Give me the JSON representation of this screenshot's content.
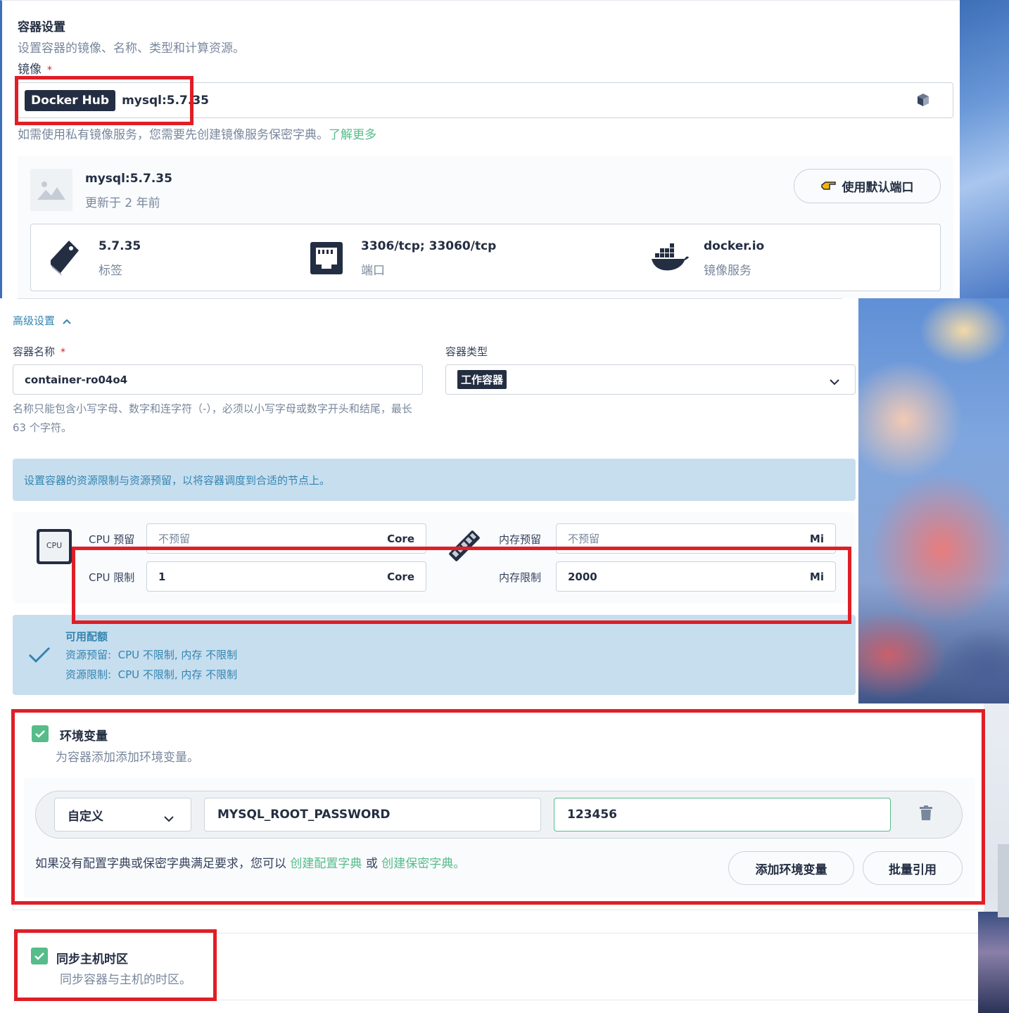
{
  "container_settings": {
    "title": "容器设置",
    "description": "设置容器的镜像、名称、类型和计算资源。",
    "image_label": "镜像",
    "required_mark": "*",
    "registry_badge": "Docker Hub",
    "image_value": "mysql:5.7.35",
    "private_registry_hint": "如需使用私有镜像服务，您需要先创建镜像服务保密字典。",
    "learn_more": "了解更多"
  },
  "image_info": {
    "name": "mysql:5.7.35",
    "updated": "更新于 2 年前",
    "use_default_ports": "使用默认端口",
    "tag_value": "5.7.35",
    "tag_label": "标签",
    "ports_value": "3306/tcp; 33060/tcp",
    "ports_label": "端口",
    "registry_value": "docker.io",
    "registry_label": "镜像服务"
  },
  "advanced": {
    "toggle_label": "高级设置",
    "container_name_label": "容器名称",
    "container_name_value": "container-ro04o4",
    "container_name_hint": "名称只能包含小写字母、数字和连字符（-），必须以小写字母或数字开头和结尾，最长 63 个字符。",
    "container_type_label": "容器类型",
    "container_type_value": "工作容器"
  },
  "resources": {
    "info_banner": "设置容器的资源限制与资源预留，以将容器调度到合适的节点上。",
    "cpu_icon_text": "CPU",
    "cpu_request_label": "CPU 预留",
    "cpu_request_placeholder": "不预留",
    "cpu_limit_label": "CPU 限制",
    "cpu_limit_value": "1",
    "cpu_unit": "Core",
    "memory_request_label": "内存预留",
    "memory_request_placeholder": "不预留",
    "memory_limit_label": "内存限制",
    "memory_limit_value": "2000",
    "memory_unit": "Mi"
  },
  "quota": {
    "title": "可用配额",
    "requests_line": "资源预留:  CPU 不限制, 内存 不限制",
    "limits_line": "资源限制:  CPU 不限制, 内存 不限制"
  },
  "env": {
    "title": "环境变量",
    "description": "为容器添加添加环境变量。",
    "type_value": "自定义",
    "key_value": "MYSQL_ROOT_PASSWORD",
    "value_value": "123456",
    "hint_prefix": "如果没有配置字典或保密字典满足要求，您可以",
    "create_configmap": "创建配置字典",
    "or_text": "或",
    "create_secret": "创建保密字典。",
    "add_button": "添加环境变量",
    "batch_button": "批量引用"
  },
  "timezone": {
    "title": "同步主机时区",
    "description": "同步容器与主机的时区。"
  },
  "colors": {
    "accent_green": "#55bc8a",
    "info_blue_bg": "#c7deef",
    "info_blue_text": "#3385b0",
    "annotation_red": "#e01e26",
    "dark_badge": "#242e42"
  }
}
